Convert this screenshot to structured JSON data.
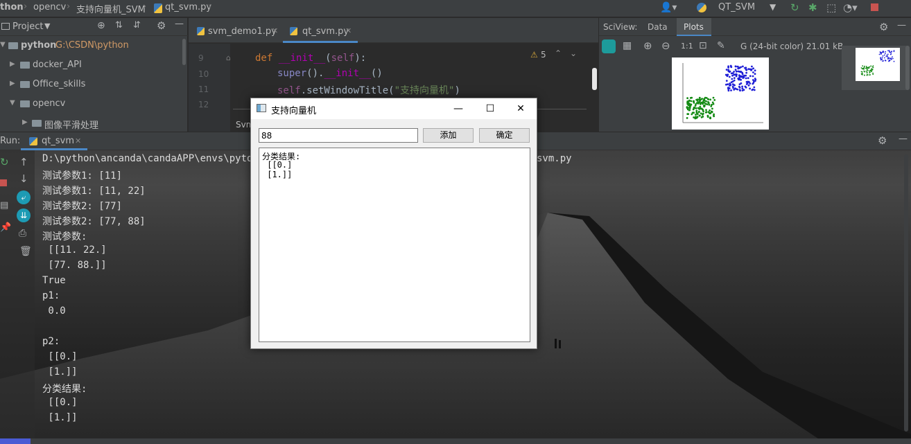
{
  "topbar": {
    "breadcrumbs": [
      "thon",
      "opencv",
      "支持向量机_SVM",
      "qt_svm.py"
    ],
    "run_config": "QT_SVM"
  },
  "project": {
    "title": "Project",
    "items": [
      {
        "label": "python",
        "path": "G:\\CSDN\\python"
      },
      {
        "label": "docker_API"
      },
      {
        "label": "Office_skills"
      },
      {
        "label": "opencv"
      },
      {
        "label": "图像平滑处理"
      }
    ]
  },
  "editor": {
    "tabs": [
      "svm_demo1.py",
      "qt_svm.py"
    ],
    "warnings": "5",
    "lines": [
      {
        "num": "9",
        "text": "def __init__(self):"
      },
      {
        "num": "10",
        "text": "    super().__init__()"
      },
      {
        "num": "11",
        "text": "    self.setWindowTitle(\"支持向量机\")"
      },
      {
        "num": "12",
        "text": ""
      }
    ],
    "breadcrumb_partial": "Svm"
  },
  "sciview": {
    "title": "SciView:",
    "tabs": [
      "Data",
      "Plots"
    ],
    "zoom_label": "1:1",
    "image_info": "G (24-bit color) 21.01 kB"
  },
  "run": {
    "label": "Run:",
    "tab": "qt_svm",
    "path_suffix": "svm.py",
    "lines": [
      "D:\\python\\ancanda\\candaAPP\\envs\\pytorc",
      "测试参数1: [11]",
      "测试参数1: [11, 22]",
      "测试参数2: [77]",
      "测试参数2: [77, 88]",
      "测试参数:",
      " [[11. 22.]",
      " [77. 88.]]",
      "True",
      "p1:",
      " 0.0",
      "",
      "p2:",
      " [[0.]",
      " [1.]]",
      "分类结果:",
      " [[0.]",
      " [1.]]"
    ]
  },
  "dialog": {
    "title": "支持向量机",
    "input_value": "88",
    "add_button": "添加",
    "ok_button": "确定",
    "output_lines": [
      "分类结果:",
      " [[0.]",
      " [1.]]"
    ]
  },
  "colors": {
    "ide_bg": "#2b2b2b",
    "panel_bg": "#3c3f41",
    "tab_underline": "#4a88c7",
    "keyword": "#cc7832",
    "magic": "#b200b2",
    "string": "#6a8759",
    "self": "#94558d"
  }
}
